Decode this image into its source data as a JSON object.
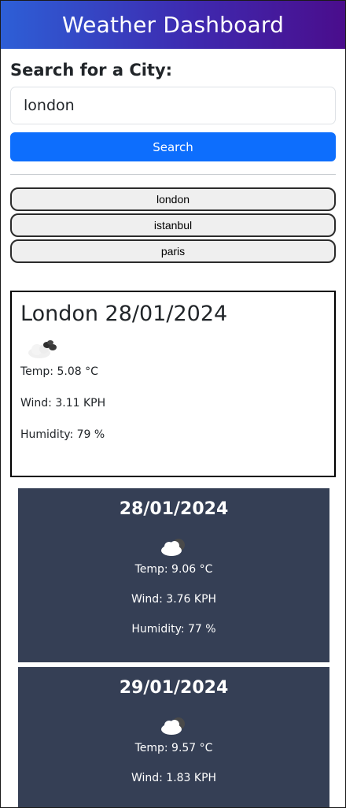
{
  "header": {
    "title": "Weather Dashboard"
  },
  "search": {
    "heading": "Search for a City:",
    "input_value": "london",
    "button_label": "Search"
  },
  "history": [
    "london",
    "istanbul",
    "paris"
  ],
  "current": {
    "title": "London 28/01/2024",
    "icon": "cloud-icon",
    "temp": "Temp: 5.08 °C",
    "wind": "Wind: 3.11 KPH",
    "humidity": "Humidity: 79 %"
  },
  "forecast": [
    {
      "date": "28/01/2024",
      "icon": "cloud-icon",
      "temp": "Temp: 9.06 °C",
      "wind": "Wind: 3.76 KPH",
      "humidity": "Humidity: 77 %"
    },
    {
      "date": "29/01/2024",
      "icon": "cloud-icon",
      "temp": "Temp: 9.57 °C",
      "wind": "Wind: 1.83 KPH",
      "humidity": ""
    }
  ],
  "colors": {
    "header_gradient_start": "#2d5fd6",
    "header_gradient_end": "#4a0d8c",
    "search_button": "#0d6efd",
    "forecast_card_bg": "#353f55"
  }
}
